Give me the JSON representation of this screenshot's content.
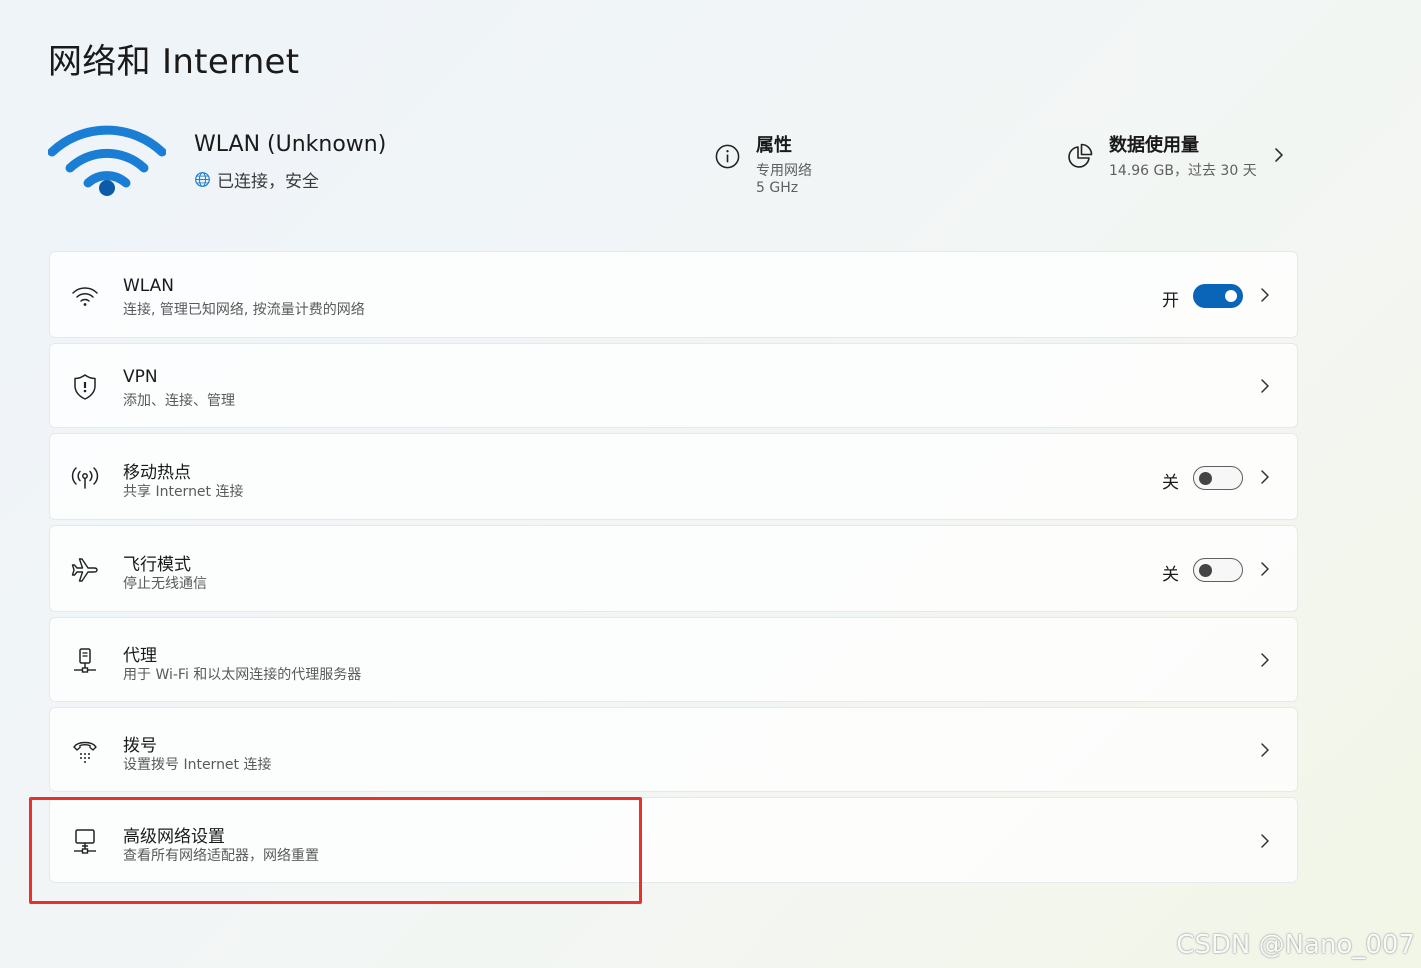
{
  "page": {
    "title": "网络和 Internet"
  },
  "header": {
    "network_name": "WLAN (Unknown)",
    "status": "已连接，安全",
    "properties": {
      "title": "属性",
      "line1": "专用网络",
      "line2": "5 GHz"
    },
    "data_usage": {
      "title": "数据使用量",
      "detail": "14.96 GB，过去 30 天"
    },
    "accent_color": "#0a64b8"
  },
  "settings": {
    "items": [
      {
        "title": "WLAN",
        "subtitle": "连接, 管理已知网络, 按流量计费的网络",
        "icon": "wifi-icon",
        "toggle_state": "开",
        "toggle_on": true
      },
      {
        "title": "VPN",
        "subtitle": "添加、连接、管理",
        "icon": "shield-icon"
      },
      {
        "title": "移动热点",
        "subtitle": "共享 Internet 连接",
        "icon": "hotspot-icon",
        "toggle_state": "关",
        "toggle_on": false
      },
      {
        "title": "飞行模式",
        "subtitle": "停止无线通信",
        "icon": "airplane-icon",
        "toggle_state": "关",
        "toggle_on": false
      },
      {
        "title": "代理",
        "subtitle": "用于 Wi-Fi 和以太网连接的代理服务器",
        "icon": "proxy-icon"
      },
      {
        "title": "拨号",
        "subtitle": "设置拨号 Internet 连接",
        "icon": "dialup-icon"
      },
      {
        "title": "高级网络设置",
        "subtitle": "查看所有网络适配器，网络重置",
        "icon": "advanced-network-icon"
      }
    ]
  },
  "annotation": {
    "highlight_color": "#e8312d"
  },
  "watermark": "CSDN @Nano_007"
}
